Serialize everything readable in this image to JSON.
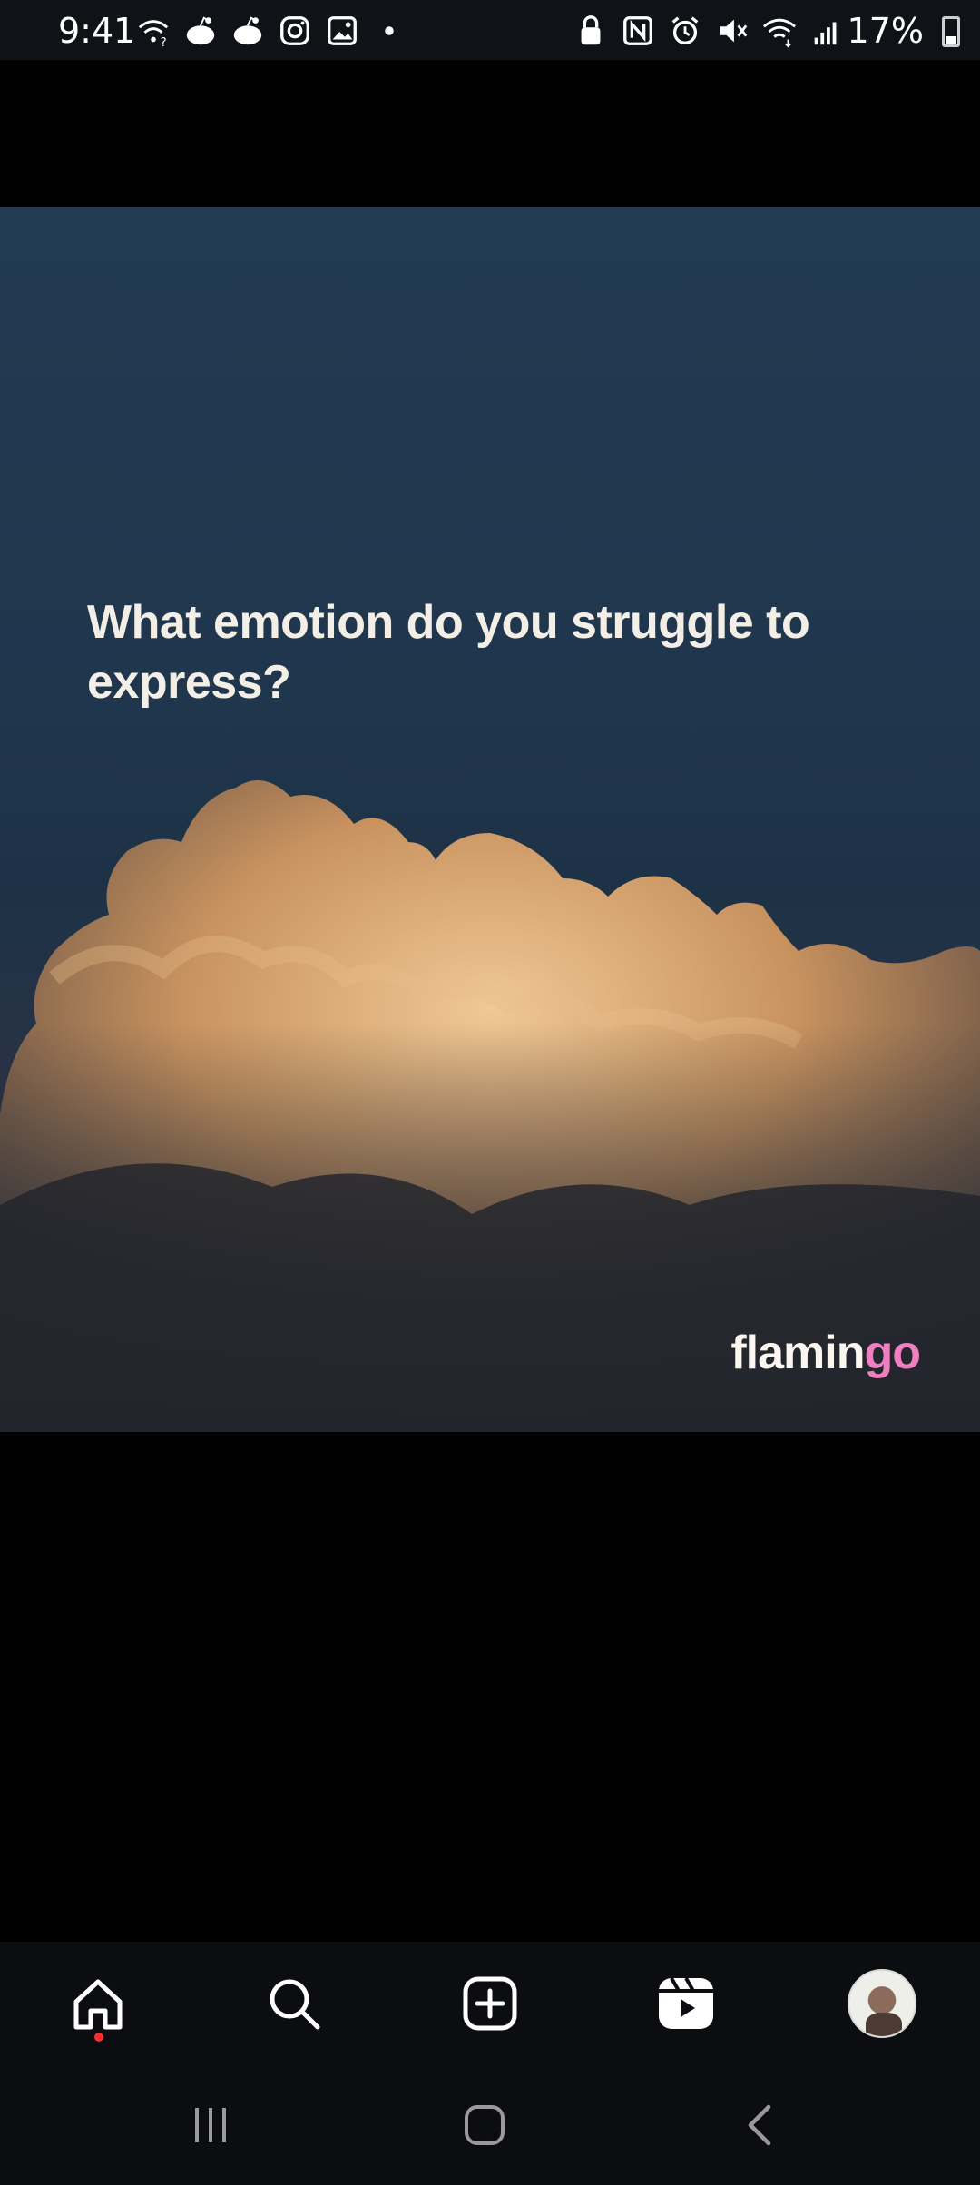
{
  "status_bar": {
    "time": "9:41",
    "battery_percent": "17%",
    "left_icons": [
      "wifi-question-icon",
      "reddit-icon",
      "reddit-icon",
      "instagram-icon",
      "gallery-icon",
      "dot-icon"
    ],
    "right_icons": [
      "lock-icon",
      "nfc-icon",
      "alarm-icon",
      "mute-icon",
      "wifi-icon",
      "signal-icon",
      "battery-icon"
    ]
  },
  "post": {
    "question": "What emotion do you struggle to express?",
    "brand_part1": "flamin",
    "brand_part2": "go"
  },
  "colors": {
    "brand_accent": "#f07fc1",
    "notification_dot": "#ff2d2d"
  },
  "bottom_nav": [
    "home-icon",
    "search-icon",
    "create-icon",
    "reels-icon",
    "profile-avatar"
  ],
  "system_nav": [
    "recents-icon",
    "home-button-icon",
    "back-icon"
  ]
}
